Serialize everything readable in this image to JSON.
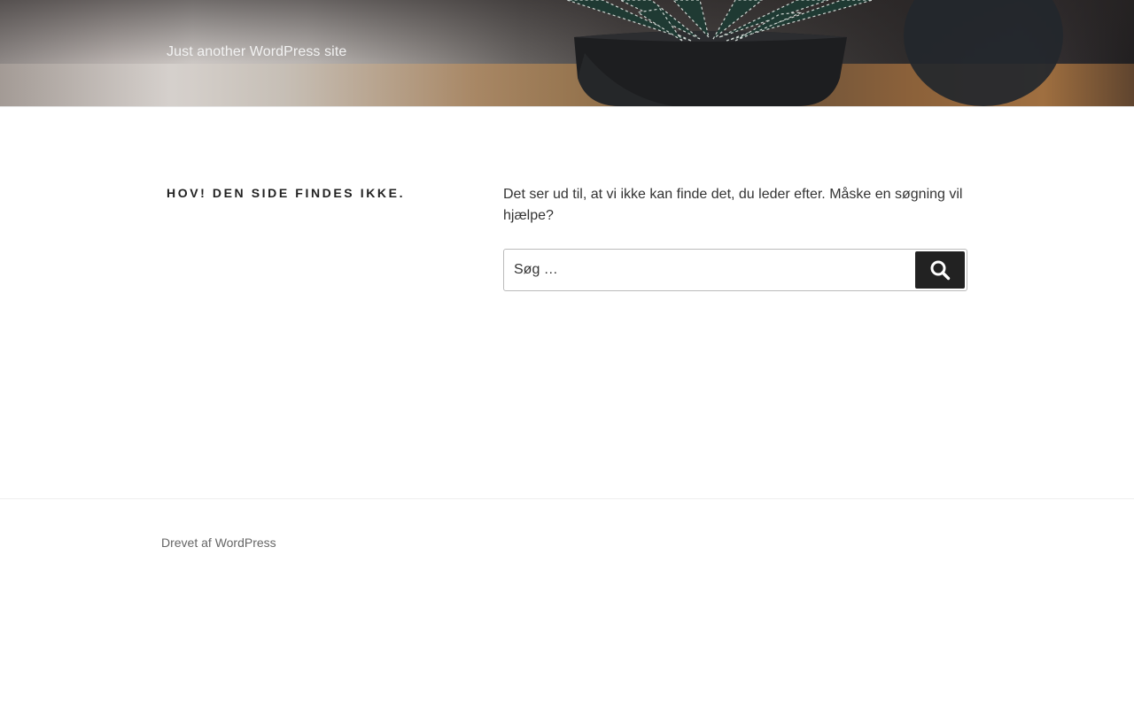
{
  "header": {
    "site_description": "Just another WordPress site"
  },
  "main": {
    "page_title": "Hov! Den side findes ikke.",
    "message": "Det ser ud til, at vi ikke kan finde det, du leder efter. Måske en søgning vil hjælpe?",
    "search": {
      "placeholder": "Søg …",
      "value": "",
      "button_icon": "search-icon"
    }
  },
  "footer": {
    "credit": "Drevet af WordPress"
  },
  "colors": {
    "button_background": "#222222",
    "text": "#222222",
    "footer_text": "#666666"
  }
}
